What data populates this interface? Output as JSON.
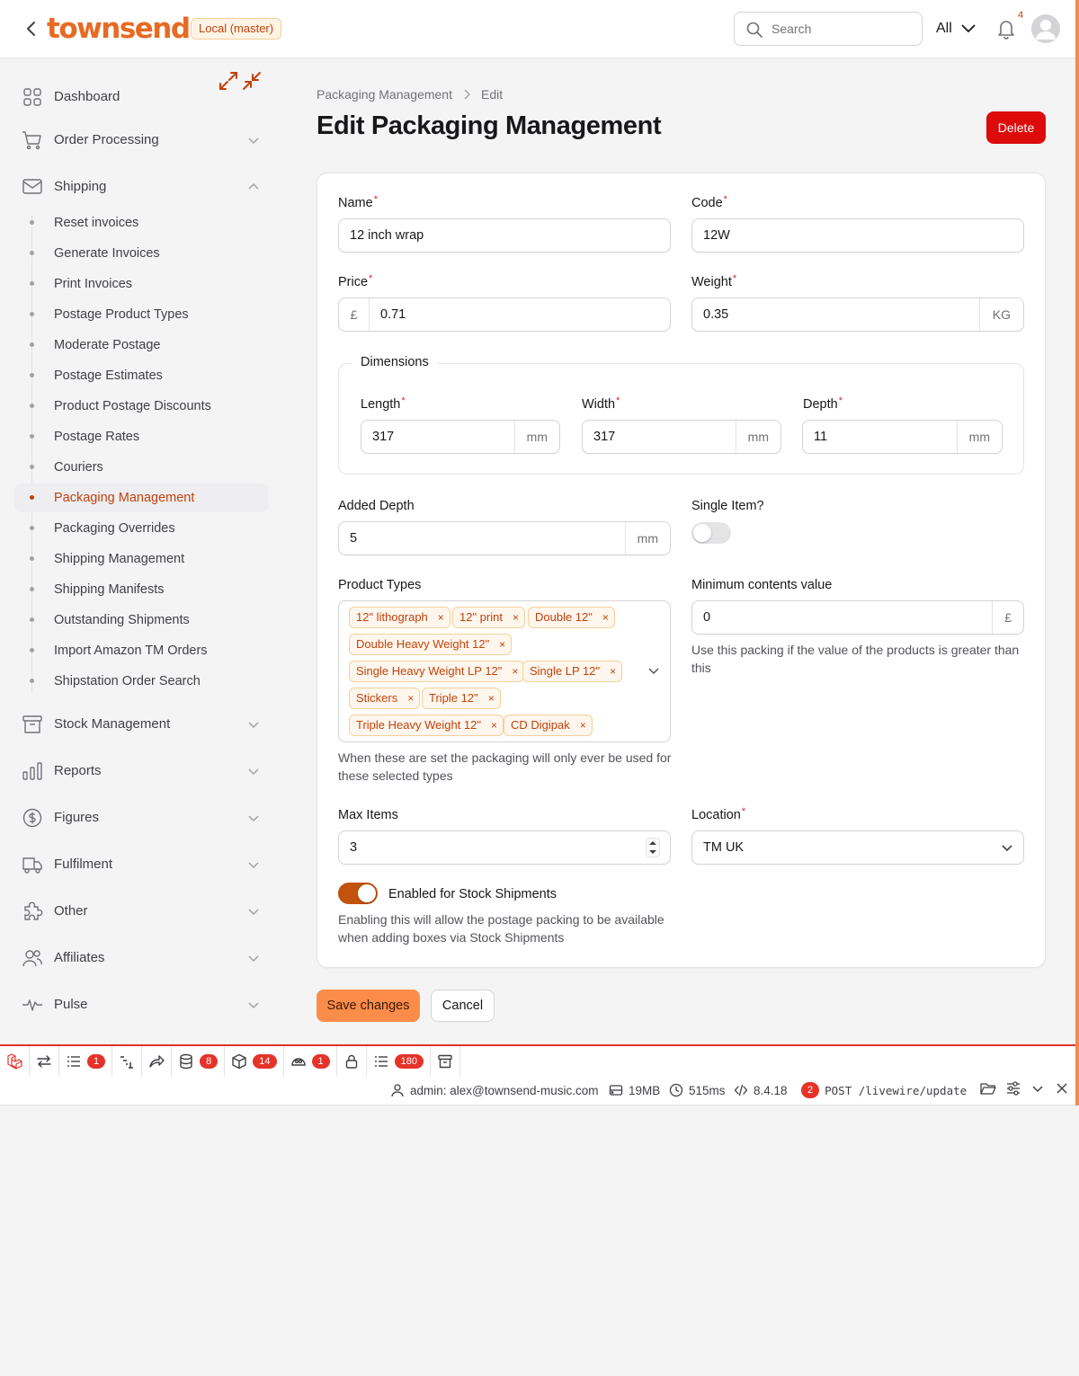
{
  "header": {
    "logo": "townsend",
    "env_badge": "Local (master)",
    "search_placeholder": "Search",
    "scope": "All",
    "notification_count": "4"
  },
  "sidebar": {
    "groups_top": [
      {
        "label": "Dashboard",
        "icon": "dashboard-icon"
      },
      {
        "label": "Order Processing",
        "icon": "cart-icon"
      },
      {
        "label": "Shipping",
        "icon": "envelope-icon"
      }
    ],
    "shipping_items": [
      "Reset invoices",
      "Generate Invoices",
      "Print Invoices",
      "Postage Product Types",
      "Moderate Postage",
      "Postage Estimates",
      "Product Postage Discounts",
      "Postage Rates",
      "Couriers",
      "Packaging Management",
      "Packaging Overrides",
      "Shipping Management",
      "Shipping Manifests",
      "Outstanding Shipments",
      "Import Amazon TM Orders",
      "Shipstation Order Search"
    ],
    "active_item": "Packaging Management",
    "groups_bottom": [
      {
        "label": "Stock Management",
        "icon": "archive-icon"
      },
      {
        "label": "Reports",
        "icon": "chart-bar-icon"
      },
      {
        "label": "Figures",
        "icon": "dollar-icon"
      },
      {
        "label": "Fulfilment",
        "icon": "truck-icon"
      },
      {
        "label": "Other",
        "icon": "puzzle-icon"
      },
      {
        "label": "Affiliates",
        "icon": "users-icon"
      },
      {
        "label": "Pulse",
        "icon": "pulse-icon"
      }
    ]
  },
  "breadcrumb": [
    "Packaging Management",
    "Edit"
  ],
  "page_title": "Edit Packaging Management",
  "delete_label": "Delete",
  "form": {
    "name": {
      "label": "Name",
      "value": "12 inch wrap"
    },
    "code": {
      "label": "Code",
      "value": "12W"
    },
    "price": {
      "label": "Price",
      "prefix": "£",
      "value": "0.71"
    },
    "weight": {
      "label": "Weight",
      "value": "0.35",
      "suffix": "KG"
    },
    "dimensions": {
      "legend": "Dimensions",
      "length": {
        "label": "Length",
        "value": "317",
        "suffix": "mm"
      },
      "width": {
        "label": "Width",
        "value": "317",
        "suffix": "mm"
      },
      "depth": {
        "label": "Depth",
        "value": "11",
        "suffix": "mm"
      }
    },
    "added_depth": {
      "label": "Added Depth",
      "value": "5",
      "suffix": "mm"
    },
    "single_item": {
      "label": "Single Item?",
      "enabled": false
    },
    "product_types": {
      "label": "Product Types",
      "tags": [
        "12\" lithograph",
        "12\" print",
        "Double 12\"",
        "Double Heavy Weight 12\"",
        "Single Heavy Weight LP 12\"",
        "Single LP 12\"",
        "Stickers",
        "Triple 12\"",
        "Triple Heavy Weight 12\"",
        "CD Digipak"
      ],
      "help": "When these are set the packaging will only ever be used for these selected types"
    },
    "min_contents": {
      "label": "Minimum contents value",
      "value": "0",
      "suffix": "£",
      "help": "Use this packing if the value of the products is greater than this"
    },
    "max_items": {
      "label": "Max Items",
      "value": "3"
    },
    "location": {
      "label": "Location",
      "value": "TM UK"
    },
    "stock_shipments": {
      "label": "Enabled for Stock Shipments",
      "enabled": true,
      "help": "Enabling this will allow the postage packing to be available when adding boxes via Stock Shipments"
    }
  },
  "actions": {
    "save": "Save changes",
    "cancel": "Cancel"
  },
  "debugbar": {
    "counts": [
      "1",
      "8",
      "14",
      "1",
      "180"
    ],
    "user": "admin: alex@townsend-music.com",
    "memory": "19MB",
    "time": "515ms",
    "php": "8.4.18",
    "request_count": "2",
    "request": "POST /livewire/update"
  },
  "colors": {
    "accent": "#c2410c",
    "brand": "#e86a22",
    "danger": "#dc0a0a",
    "save": "#fb8c4a",
    "toggle_on": "#c2520c"
  }
}
